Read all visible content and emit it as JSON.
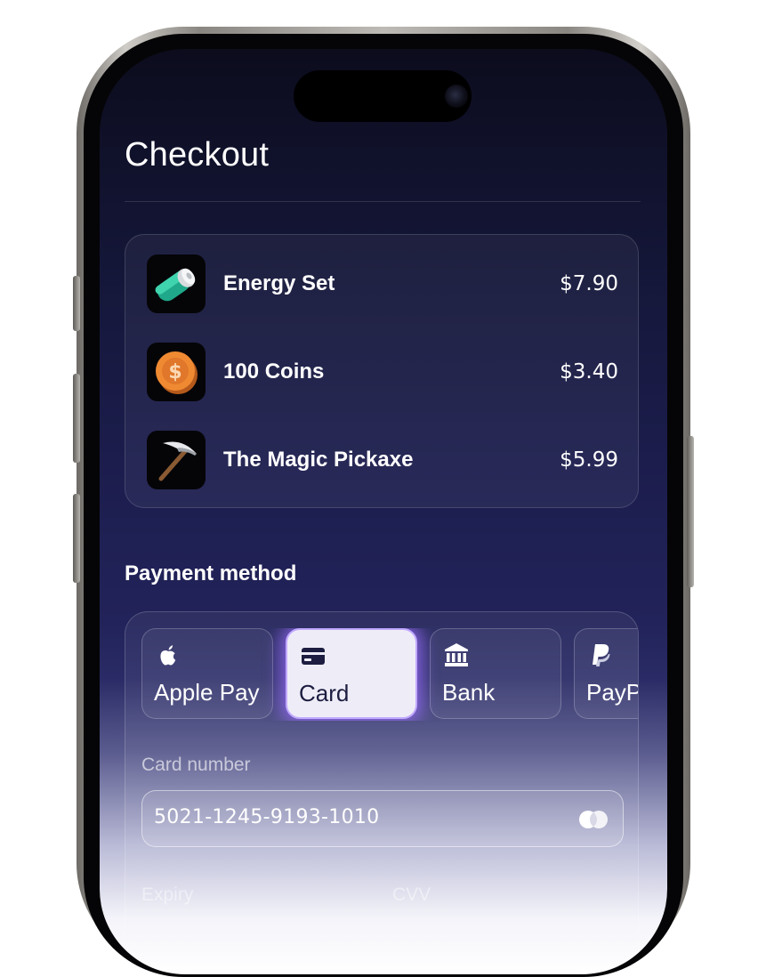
{
  "screen": {
    "title": "Checkout"
  },
  "order": {
    "items": [
      {
        "name": "Energy Set",
        "price": "$7.90",
        "icon": "battery-icon"
      },
      {
        "name": "100 Coins",
        "price": "$3.40",
        "icon": "coin-icon"
      },
      {
        "name": "The Magic Pickaxe",
        "price": "$5.99",
        "icon": "pickaxe-icon"
      }
    ]
  },
  "payment": {
    "section_label": "Payment method",
    "methods": [
      {
        "label": "Apple Pay",
        "icon": "apple-icon",
        "selected": false
      },
      {
        "label": "Card",
        "icon": "credit-card-icon",
        "selected": true
      },
      {
        "label": "Bank",
        "icon": "bank-icon",
        "selected": false
      },
      {
        "label": "PayPal",
        "icon": "paypal-icon",
        "selected": false
      }
    ],
    "card_number_label": "Card number",
    "card_number_value": "5021-1245-9193-1010",
    "card_brand_icon": "mastercard-icon",
    "expiry_label": "Expiry",
    "cvv_label": "CVV"
  },
  "colors": {
    "background_top": "#0c0c1d",
    "background_mid": "#1c1d4d",
    "selected_glow": "#9b6eff",
    "selected_fill": "#eeedf7",
    "text": "#ffffff"
  }
}
